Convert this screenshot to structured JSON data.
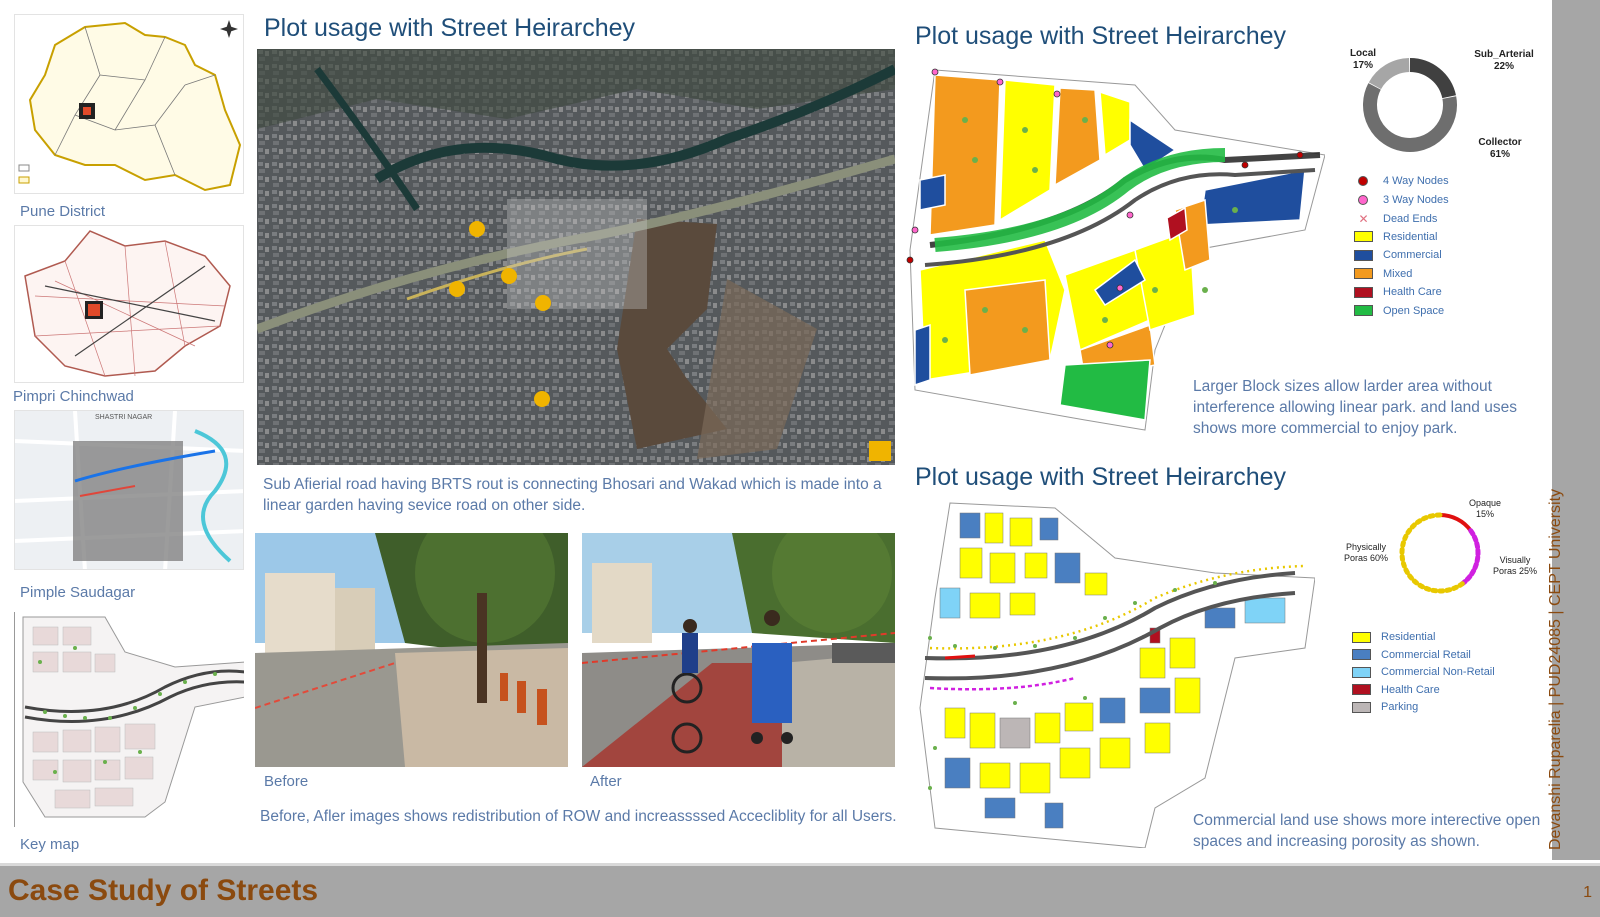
{
  "footer": {
    "title": "Case Study of Streets",
    "page_number": "1"
  },
  "side_text": "Devanshi Ruparelia | PUD24085 | CEPT University",
  "left_maps": [
    {
      "label": "Pune District"
    },
    {
      "label": "Pimpri Chinchwad"
    },
    {
      "label": "Pimple Saudagar"
    },
    {
      "label": "Key map"
    }
  ],
  "center": {
    "heading": "Plot usage with Street Heirarchey",
    "satellite_caption": "Sub Afierial road having BRTS rout is connecting Bhosari and Wakad which is made into a linear garden having sevice road on other side.",
    "before_label": "Before",
    "after_label": "After",
    "bottom_caption": "Before, Afler images shows redistribution of ROW and increassssed Accecliblity for all Users."
  },
  "right_top": {
    "heading": "Plot usage with Street Heirarchey",
    "caption": "Larger Block sizes allow larder area without interference allowing linear park. and land uses shows more commercial to enjoy park.",
    "donut": {
      "segments": [
        {
          "name": "Local",
          "value": 17,
          "label": "Local\n17%",
          "color": "#a6a6a6"
        },
        {
          "name": "Sub_Arterial",
          "value": 22,
          "label": "Sub_Arterial\n22%",
          "color": "#404040"
        },
        {
          "name": "Collector",
          "value": 61,
          "label": "Collector\n61%",
          "color": "#6e6e6e"
        }
      ],
      "labels": {
        "local": "Local",
        "local_pct": "17%",
        "sub": "Sub_Arterial",
        "sub_pct": "22%",
        "col": "Collector",
        "col_pct": "61%"
      }
    },
    "legend": [
      {
        "label": "4 Way Nodes",
        "kind": "dot",
        "color": "#c00000"
      },
      {
        "label": "3 Way Nodes",
        "kind": "dot",
        "color": "#ff66cc"
      },
      {
        "label": "Dead Ends",
        "kind": "cross",
        "color": "#e07080"
      },
      {
        "label": "Residential",
        "kind": "swatch",
        "color": "#ffff00"
      },
      {
        "label": "Commercial",
        "kind": "swatch",
        "color": "#1f4e9e"
      },
      {
        "label": "Mixed",
        "kind": "swatch",
        "color": "#f39a1e"
      },
      {
        "label": "Health Care",
        "kind": "swatch",
        "color": "#b01020"
      },
      {
        "label": "Open Space",
        "kind": "swatch",
        "color": "#22bb44"
      }
    ]
  },
  "right_bottom": {
    "heading": "Plot usage with Street Heirarchey",
    "caption": "Commercial land use shows more interective open spaces and increasing porosity as shown.",
    "porosity": {
      "labels": {
        "opaque": "Opaque",
        "opaque_pct": "15%",
        "phys": "Physically",
        "phys_pct": "Poras 60%",
        "vis": "Visually",
        "vis_pct": "Poras 25%"
      },
      "segments": [
        {
          "name": "Opaque",
          "value": 15,
          "color": "#e01010"
        },
        {
          "name": "Visually Poras",
          "value": 25,
          "color": "#d020e0"
        },
        {
          "name": "Physically Poras",
          "value": 60,
          "color": "#e8c800"
        }
      ]
    },
    "legend": [
      {
        "label": "Residential",
        "color": "#ffff00"
      },
      {
        "label": "Commercial Retail",
        "color": "#4a7fc1"
      },
      {
        "label": "Commercial Non-Retail",
        "color": "#7fd3f7"
      },
      {
        "label": "Health Care",
        "color": "#b01020"
      },
      {
        "label": "Parking",
        "color": "#bcb6b6"
      }
    ]
  }
}
